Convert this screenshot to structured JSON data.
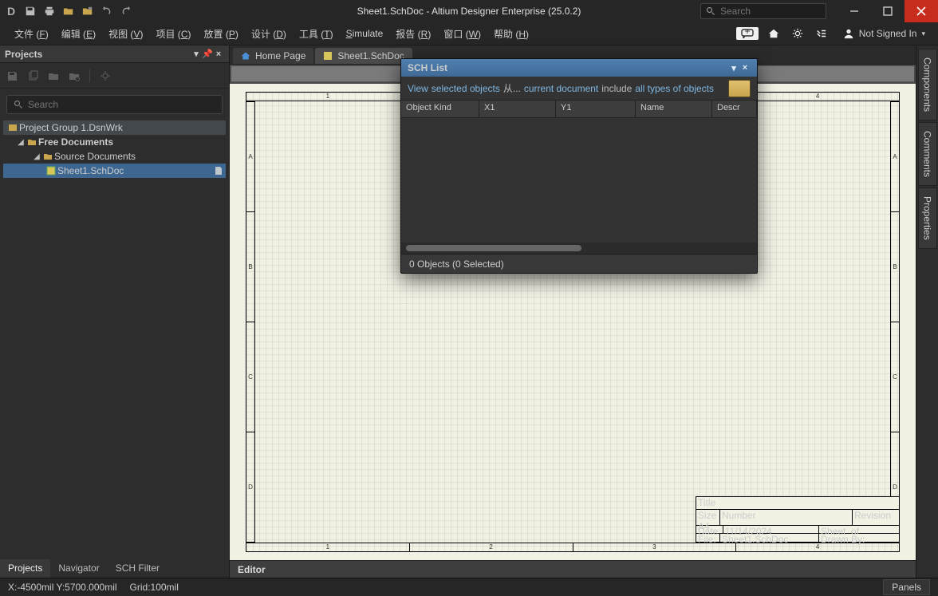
{
  "title": "Sheet1.SchDoc - Altium Designer Enterprise (25.0.2)",
  "search_placeholder": "Search",
  "signin_label": "Not Signed In",
  "menu": {
    "file": {
      "label": "文件",
      "accel": "F"
    },
    "edit": {
      "label": "编辑",
      "accel": "E"
    },
    "view": {
      "label": "视图",
      "accel": "V"
    },
    "project": {
      "label": "项目",
      "accel": "C"
    },
    "place": {
      "label": "放置",
      "accel": "P"
    },
    "design": {
      "label": "设计",
      "accel": "D"
    },
    "tools": {
      "label": "工具",
      "accel": "T"
    },
    "simulate": {
      "label": "Simulate",
      "accel": "S",
      "latin": true
    },
    "reports": {
      "label": "报告",
      "accel": "R"
    },
    "window": {
      "label": "窗口",
      "accel": "W"
    },
    "help": {
      "label": "帮助",
      "accel": "H"
    }
  },
  "projects_panel": {
    "title": "Projects",
    "search_placeholder": "Search",
    "tabs": [
      "Projects",
      "Navigator",
      "SCH Filter"
    ],
    "tree": {
      "root": "Project Group 1.DsnWrk",
      "free": "Free Documents",
      "src": "Source Documents",
      "doc": "Sheet1.SchDoc"
    }
  },
  "tabs": {
    "home": "Home Page",
    "sheet": "Sheet1.SchDoc"
  },
  "editor_label": "Editor",
  "statusbar": {
    "coords": "X:-4500mil Y:5700.000mil",
    "grid": "Grid:100mil",
    "panels": "Panels"
  },
  "right_dock": [
    "Components",
    "Comments",
    "Properties"
  ],
  "rulers": {
    "cols": [
      "1",
      "2",
      "3",
      "4"
    ],
    "rows": [
      "A",
      "B",
      "C",
      "D"
    ]
  },
  "title_block": {
    "title": "Title",
    "size_lbl": "Size",
    "size": "A4",
    "number": "Number",
    "revision": "Revision",
    "date_lbl": "Date:",
    "date": "11/14/2024",
    "sheet": "Sheet",
    "of": "of",
    "file_lbl": "File:",
    "file": "Sheet1.SchDoc",
    "drawn": "Drawn By:"
  },
  "sch_list": {
    "title": "SCH List",
    "filter": {
      "view": "View",
      "selected": "selected objects",
      "from": "从...",
      "ellipsis": "...",
      "current": "current document",
      "include": "include",
      "types": "all types of objects"
    },
    "columns": [
      "Object Kind",
      "X1",
      "Y1",
      "Name",
      "Description"
    ],
    "footer": "0 Objects (0 Selected)"
  }
}
